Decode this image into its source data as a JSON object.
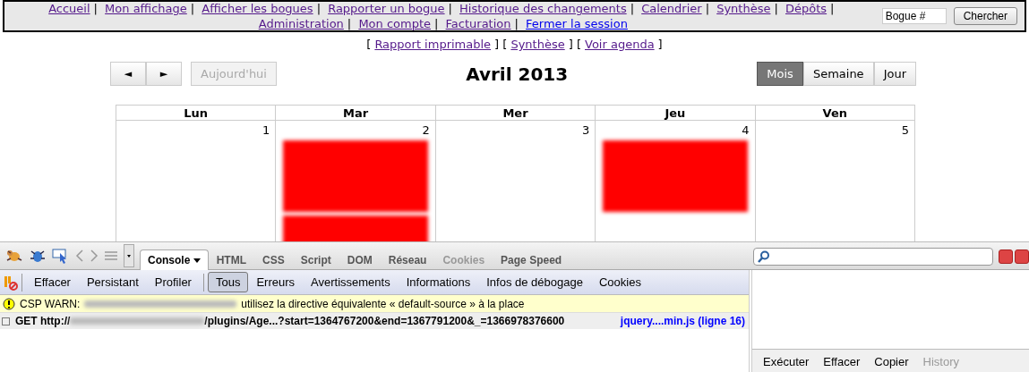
{
  "nav": {
    "separator": "|",
    "links": [
      {
        "label": "Accueil",
        "visited": true
      },
      {
        "label": "Mon affichage",
        "visited": true
      },
      {
        "label": "Afficher les bogues",
        "visited": true
      },
      {
        "label": "Rapporter un bogue",
        "visited": true
      },
      {
        "label": "Historique des changements",
        "visited": true
      },
      {
        "label": "Calendrier",
        "visited": true
      },
      {
        "label": "Synthèse",
        "visited": true
      },
      {
        "label": "Dépôts",
        "visited": true
      },
      {
        "label": "Administration",
        "visited": true
      },
      {
        "label": "Mon compte",
        "visited": true
      },
      {
        "label": "Facturation",
        "visited": true
      },
      {
        "label": "Fermer la session",
        "visited": false
      }
    ],
    "search": {
      "value": "Bogue #"
    },
    "search_button": "Chercher"
  },
  "subnav": {
    "open": "[",
    "close": "]",
    "links": [
      "Rapport imprimable",
      "Synthèse",
      "Voir agenda"
    ]
  },
  "calendar": {
    "prev": "◄",
    "next": "►",
    "today": {
      "label": "Aujourd'hui",
      "disabled": true
    },
    "title": "Avril 2013",
    "views": [
      {
        "label": "Mois",
        "selected": true
      },
      {
        "label": "Semaine",
        "selected": false
      },
      {
        "label": "Jour",
        "selected": false
      }
    ],
    "days": [
      "Lun",
      "Mar",
      "Mer",
      "Jeu",
      "Ven"
    ],
    "cells": [
      {
        "day": "1"
      },
      {
        "day": "2",
        "events": [
          {
            "color": "#ff0000"
          },
          {
            "color": "#ff0000"
          }
        ]
      },
      {
        "day": "3"
      },
      {
        "day": "4",
        "events": [
          {
            "color": "#ff0000"
          }
        ]
      },
      {
        "day": "5"
      }
    ]
  },
  "firebug": {
    "tabs": [
      {
        "label": "Console",
        "selected": true,
        "dim": false
      },
      {
        "label": "HTML",
        "selected": false,
        "dim": false
      },
      {
        "label": "CSS",
        "selected": false,
        "dim": false
      },
      {
        "label": "Script",
        "selected": false,
        "dim": false
      },
      {
        "label": "DOM",
        "selected": false,
        "dim": false
      },
      {
        "label": "Réseau",
        "selected": false,
        "dim": false
      },
      {
        "label": "Cookies",
        "selected": false,
        "dim": true
      },
      {
        "label": "Page Speed",
        "selected": false,
        "dim": false
      }
    ],
    "buttons": [
      "Effacer",
      "Persistant",
      "Profiler"
    ],
    "filters": [
      {
        "label": "Tous",
        "selected": true
      },
      {
        "label": "Erreurs",
        "selected": false
      },
      {
        "label": "Avertissements",
        "selected": false
      },
      {
        "label": "Informations",
        "selected": false
      },
      {
        "label": "Infos de débogage",
        "selected": false
      },
      {
        "label": "Cookies",
        "selected": false
      }
    ],
    "messages": [
      {
        "kind": "warning",
        "prefix": "CSP WARN:",
        "text": "utilisez la directive équivalente « default-source » à la place"
      },
      {
        "kind": "request",
        "method": "GET http://",
        "url": "/plugins/Age...?start=1364767200&end=1367791200&_=1366978376600",
        "source": "jquery....min.js (ligne 16)"
      }
    ],
    "command_buttons": [
      {
        "label": "Exécuter",
        "disabled": false
      },
      {
        "label": "Effacer",
        "disabled": false
      },
      {
        "label": "Copier",
        "disabled": false
      },
      {
        "label": "History",
        "disabled": true
      }
    ]
  }
}
